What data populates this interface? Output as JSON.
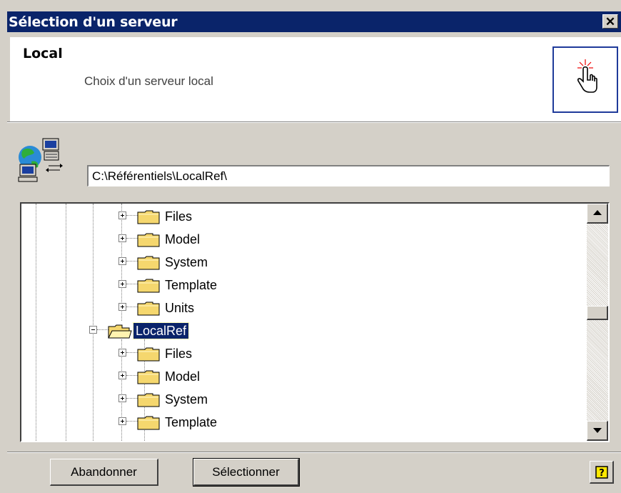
{
  "window": {
    "title": "Sélection d'un serveur",
    "close_glyph": "✕"
  },
  "header": {
    "title": "Local",
    "subtitle": "Choix d'un serveur local",
    "icon": "hand-pointer-icon"
  },
  "server": {
    "icon": "network-server-icon",
    "path_value": "C:\\Référentiels\\LocalRef\\"
  },
  "tree": {
    "nodes": [
      {
        "label": "Files",
        "expander": "plus",
        "selected": false
      },
      {
        "label": "Model",
        "expander": "plus",
        "selected": false
      },
      {
        "label": "System",
        "expander": "plus",
        "selected": false
      },
      {
        "label": "Template",
        "expander": "plus",
        "selected": false
      },
      {
        "label": "Units",
        "expander": "plus",
        "selected": false
      },
      {
        "label": "LocalRef",
        "expander": "minus",
        "selected": true
      },
      {
        "label": "Files",
        "expander": "plus",
        "selected": false
      },
      {
        "label": "Model",
        "expander": "plus",
        "selected": false
      },
      {
        "label": "System",
        "expander": "plus",
        "selected": false
      },
      {
        "label": "Template",
        "expander": "plus",
        "selected": false
      }
    ],
    "scroll_position": 0.45
  },
  "buttons": {
    "cancel_label": "Abandonner",
    "select_label": "Sélectionner",
    "help_glyph": "?"
  },
  "colors": {
    "titlebar": "#0a246a",
    "selection": "#0a246a",
    "folder": "#f5d76e",
    "dialog_face": "#d4d0c8"
  }
}
